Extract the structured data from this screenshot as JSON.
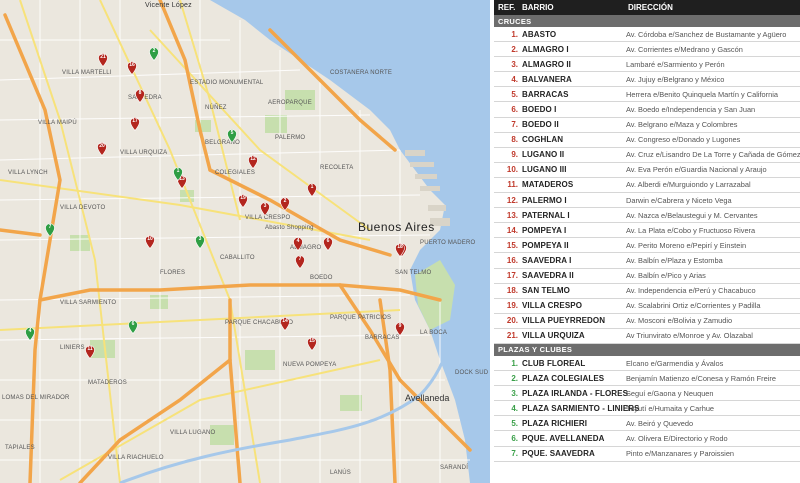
{
  "map": {
    "places": {
      "vicente_lopez": "Vicente López",
      "buenos_aires": "Buenos Aires",
      "avellaneda": "Avellaneda",
      "villa_martelli": "Villa Martelli",
      "villa_maipu": "Villa Maipú",
      "villa_lynch": "Villa Lynch",
      "villa_sarmiento": "Villa Sarmiento",
      "mataderos": "Mataderos",
      "liniers": "Liniers",
      "palermo": "Palermo",
      "belgrano": "Belgrano",
      "recoleta": "Recoleta",
      "caballito": "Caballito",
      "flores": "Flores",
      "abasto": "Abasto Shopping",
      "parque_chacabuco": "Parque Chacabuco",
      "nueva_pompeya": "Nueva Pompeya",
      "villa_lugano": "Villa Lugano",
      "san_telmo": "San Telmo",
      "puerto_madero": "Puerto Madero",
      "la_boca": "La Boca",
      "dock_sud": "Dock Sud",
      "sarandi": "Sarandí",
      "lanus": "Lanús",
      "nunez": "Núñez",
      "saavedra": "Saavedra",
      "villa_urquiza": "Villa Urquiza",
      "villa_devoto": "Villa Devoto",
      "colegiales": "Colegiales",
      "almagro": "Almagro",
      "boedo": "Boedo",
      "villa_crespo": "Villa Crespo",
      "costanera": "Costanera Norte",
      "villa_riachuelo": "Villa Riachuelo",
      "lomas": "Lomas del Mirador",
      "tapiales": "Tapiales",
      "barracas": "Barracas",
      "parque_patricios": "Parque Patricios",
      "estadio": "Estadio Monumental",
      "aeroparque": "Aeroparque"
    },
    "red_markers": [
      "1",
      "2",
      "3",
      "4",
      "5",
      "6",
      "7",
      "8",
      "9",
      "10",
      "11",
      "12",
      "13",
      "14",
      "15",
      "16",
      "17",
      "18",
      "19",
      "20",
      "21"
    ],
    "green_markers": [
      "1",
      "2",
      "3",
      "4",
      "5",
      "6",
      "7"
    ]
  },
  "table": {
    "col_ref": "REF.",
    "col_barrio": "BARRIO",
    "col_direccion": "DIRECCIÓN",
    "section_cruces": "CRUCES",
    "section_plazas": "PLAZAS Y CLUBES",
    "cruces": [
      {
        "n": "1.",
        "barrio": "ABASTO",
        "dir": "Av. Córdoba e/Sanchez de Bustamante y Agüero"
      },
      {
        "n": "2.",
        "barrio": "ALMAGRO I",
        "dir": "Av. Corrientes e/Medrano y Gascón"
      },
      {
        "n": "3.",
        "barrio": "ALMAGRO II",
        "dir": "Lambaré e/Sarmiento y Perón"
      },
      {
        "n": "4.",
        "barrio": "BALVANERA",
        "dir": "Av. Jujuy e/Belgrano y México"
      },
      {
        "n": "5.",
        "barrio": "BARRACAS",
        "dir": "Herrera e/Benito Quinquela Martín y California"
      },
      {
        "n": "6.",
        "barrio": "BOEDO I",
        "dir": "Av. Boedo e/Independencia y San Juan"
      },
      {
        "n": "7.",
        "barrio": "BOEDO II",
        "dir": "Av. Belgrano e/Maza y Colombres"
      },
      {
        "n": "8.",
        "barrio": "COGHLAN",
        "dir": "Av. Congreso e/Donado y Lugones"
      },
      {
        "n": "9.",
        "barrio": "LUGANO II",
        "dir": "Av. Cruz e/Lisandro De La Torre y Cañada de Gómez"
      },
      {
        "n": "10.",
        "barrio": "LUGANO III",
        "dir": "Av. Eva Perón e/Guardia Nacional y Araujo"
      },
      {
        "n": "11.",
        "barrio": "MATADEROS",
        "dir": "Av. Alberdi e/Murguiondo y Larrazabal"
      },
      {
        "n": "12.",
        "barrio": "PALERMO I",
        "dir": "Darwin e/Cabrera y Niceto Vega"
      },
      {
        "n": "13.",
        "barrio": "PATERNAL I",
        "dir": "Av. Nazca e/Belaustegui y M. Cervantes"
      },
      {
        "n": "14.",
        "barrio": "POMPEYA I",
        "dir": "Av. La Plata e/Cobo y Fructuoso Rivera"
      },
      {
        "n": "15.",
        "barrio": "POMPEYA II",
        "dir": "Av. Perito Moreno e/Pepirí y Einstein"
      },
      {
        "n": "16.",
        "barrio": "SAAVEDRA I",
        "dir": "Av. Balbín e/Plaza y Estomba"
      },
      {
        "n": "17.",
        "barrio": "SAAVEDRA II",
        "dir": "Av. Balbín e/Pico y Arias"
      },
      {
        "n": "18.",
        "barrio": "SAN TELMO",
        "dir": "Av. Independencia e/Perú y Chacabuco"
      },
      {
        "n": "19.",
        "barrio": "VILLA CRESPO",
        "dir": "Av. Scalabrini Ortiz e/Corrientes y Padilla"
      },
      {
        "n": "20.",
        "barrio": "VILLA PUEYRREDON",
        "dir": "Av. Mosconi e/Bolivia y Zamudio"
      },
      {
        "n": "21.",
        "barrio": "VILLA URQUIZA",
        "dir": "Av Triunvirato e/Monroe y Av. Olazabal"
      }
    ],
    "plazas": [
      {
        "n": "1.",
        "barrio": "CLUB FLOREAL",
        "dir": "Elcano e/Garmendia y Ávalos"
      },
      {
        "n": "2.",
        "barrio": "PLAZA COLEGIALES",
        "dir": "Benjamín Matienzo e/Conesa y Ramón Freire"
      },
      {
        "n": "3.",
        "barrio": "PLAZA IRLANDA - FLORES",
        "dir": "Seguí e/Gaona y Neuquen"
      },
      {
        "n": "4.",
        "barrio": "PLAZA SARMIENTO - LINIERS",
        "dir": "Tuyutí e/Humaita y Carhue"
      },
      {
        "n": "5.",
        "barrio": "PLAZA RICHIERI",
        "dir": "Av. Beiró y Quevedo"
      },
      {
        "n": "6.",
        "barrio": "PQUE. AVELLANEDA",
        "dir": "Av. Olivera E/Directorio y Rodo"
      },
      {
        "n": "7.",
        "barrio": "PQUE. SAAVEDRA",
        "dir": "Pinto e/Manzanares y Paroissien"
      }
    ]
  },
  "colors": {
    "red_pin": "#b3261e",
    "green_pin": "#2f9e44",
    "water": "#a6c8ea",
    "highway": "#f2a54a",
    "park": "#c7dfae"
  }
}
